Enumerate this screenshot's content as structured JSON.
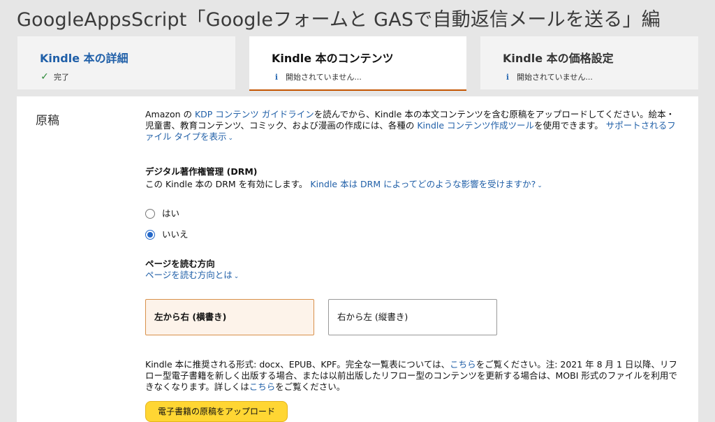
{
  "page_title": "GoogleAppsScript「Googleフォームと GASで自動返信メールを送る」編",
  "tabs": [
    {
      "title": "Kindle 本の詳細",
      "status": "完了",
      "icon": "check-icon"
    },
    {
      "title": "Kindle 本のコンテンツ",
      "status": "開始されていません...",
      "icon": "info-icon"
    },
    {
      "title": "Kindle 本の価格設定",
      "status": "開始されていません...",
      "icon": "info-icon"
    }
  ],
  "manuscript": {
    "section_label": "原稿",
    "intro_1": "Amazon の ",
    "intro_link_guideline": "KDP コンテンツ ガイドライン",
    "intro_2": "を読んでから、Kindle 本の本文コンテンツを含む原稿をアップロードしてください。絵本・児童書、教育コンテンツ、コミック、および漫画の作成には、各種の ",
    "intro_link_tools": "Kindle コンテンツ作成ツール",
    "intro_3": "を使用できます。",
    "intro_link_types": "サポートされるファイル タイプを表示",
    "drm": {
      "heading": "デジタル著作権管理 (DRM)",
      "text": "この Kindle 本の DRM を有効にします。",
      "link": "Kindle 本は DRM によってどのような影響を受けますか?",
      "options": [
        {
          "label": "はい",
          "selected": false
        },
        {
          "label": "いいえ",
          "selected": true
        }
      ]
    },
    "direction": {
      "heading": "ページを読む方向",
      "link": "ページを読む方向とは",
      "options": [
        {
          "label": "左から右 (横書き)",
          "selected": true
        },
        {
          "label": "右から左 (縦書き)",
          "selected": false
        }
      ]
    },
    "formats": {
      "text_1": "Kindle 本に推奨される形式: docx、EPUB、KPF。完全な一覧表については、",
      "link_1": "こちら",
      "text_2": "をご覧ください。注: 2021 年 8 月 1 日以降、リフロー型電子書籍を新しく出版する場合、または以前出版したリフロー型のコンテンツを更新する場合は、MOBI 形式のファイルを利用できなくなります。詳しくは",
      "link_2": "こちら",
      "text_3": "をご覧ください。"
    },
    "upload_button": "電子書籍の原稿をアップロード"
  },
  "colors": {
    "link": "#2160a8",
    "active_tab_underline": "#c45500",
    "upload_button": "#ffd633",
    "radio_selected": "#2468c9"
  }
}
